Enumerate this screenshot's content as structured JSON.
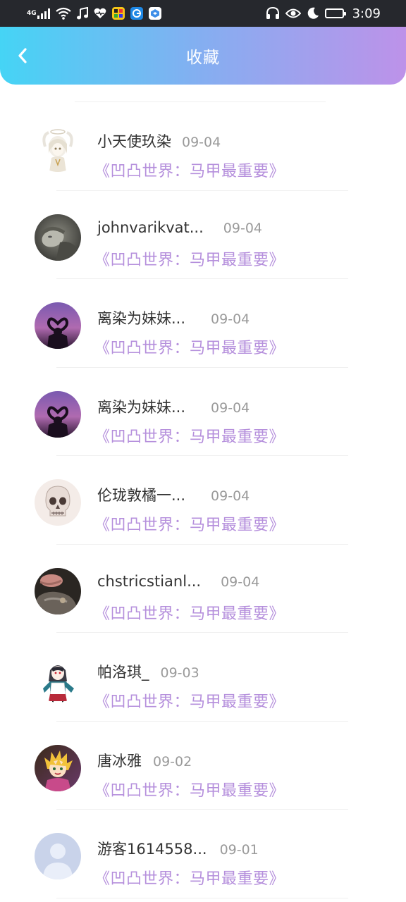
{
  "status_bar": {
    "network": "4G",
    "time": "3:09",
    "icons": [
      "signal-icon",
      "wifi-icon",
      "music-note-icon",
      "heart-icon",
      "app-icon-1",
      "app-icon-2",
      "app-icon-3",
      "headphones-icon",
      "eye-icon",
      "moon-icon",
      "battery-icon"
    ],
    "battery_level": 0.8
  },
  "header": {
    "title": "收藏",
    "back_icon": "chevron-left-icon",
    "gradient": [
      "#45d4f5",
      "#bd92e9"
    ]
  },
  "list": {
    "title_color": "#b58fdc",
    "items": [
      {
        "name": "小天使玖染",
        "date": "09-04",
        "title": "《凹凸世界：马甲最重要》",
        "avatar": "anime-angel"
      },
      {
        "name": "johnvarikvat...",
        "date": "09-04",
        "title": "《凹凸世界：马甲最重要》",
        "avatar": "grey-photo"
      },
      {
        "name": "离染为妹妹...",
        "date": "09-04",
        "title": "《凹凸世界：马甲最重要》",
        "avatar": "purple-sky"
      },
      {
        "name": "离染为妹妹...",
        "date": "09-04",
        "title": "《凹凸世界：马甲最重要》",
        "avatar": "purple-sky"
      },
      {
        "name": "伦珑敦橘一...",
        "date": "09-04",
        "title": "《凹凸世界：马甲最重要》",
        "avatar": "skull"
      },
      {
        "name": "chstricstianl...",
        "date": "09-04",
        "title": "《凹凸世界：马甲最重要》",
        "avatar": "dark-photo"
      },
      {
        "name": "帕洛琪_",
        "date": "09-03",
        "title": "《凹凸世界：马甲最重要》",
        "avatar": "anime-girl"
      },
      {
        "name": "唐冰雅",
        "date": "09-02",
        "title": "《凹凸世界：马甲最重要》",
        "avatar": "anime-blonde"
      },
      {
        "name": "游客1614558...",
        "date": "09-01",
        "title": "《凹凸世界：马甲最重要》",
        "avatar": "default-person"
      }
    ]
  }
}
